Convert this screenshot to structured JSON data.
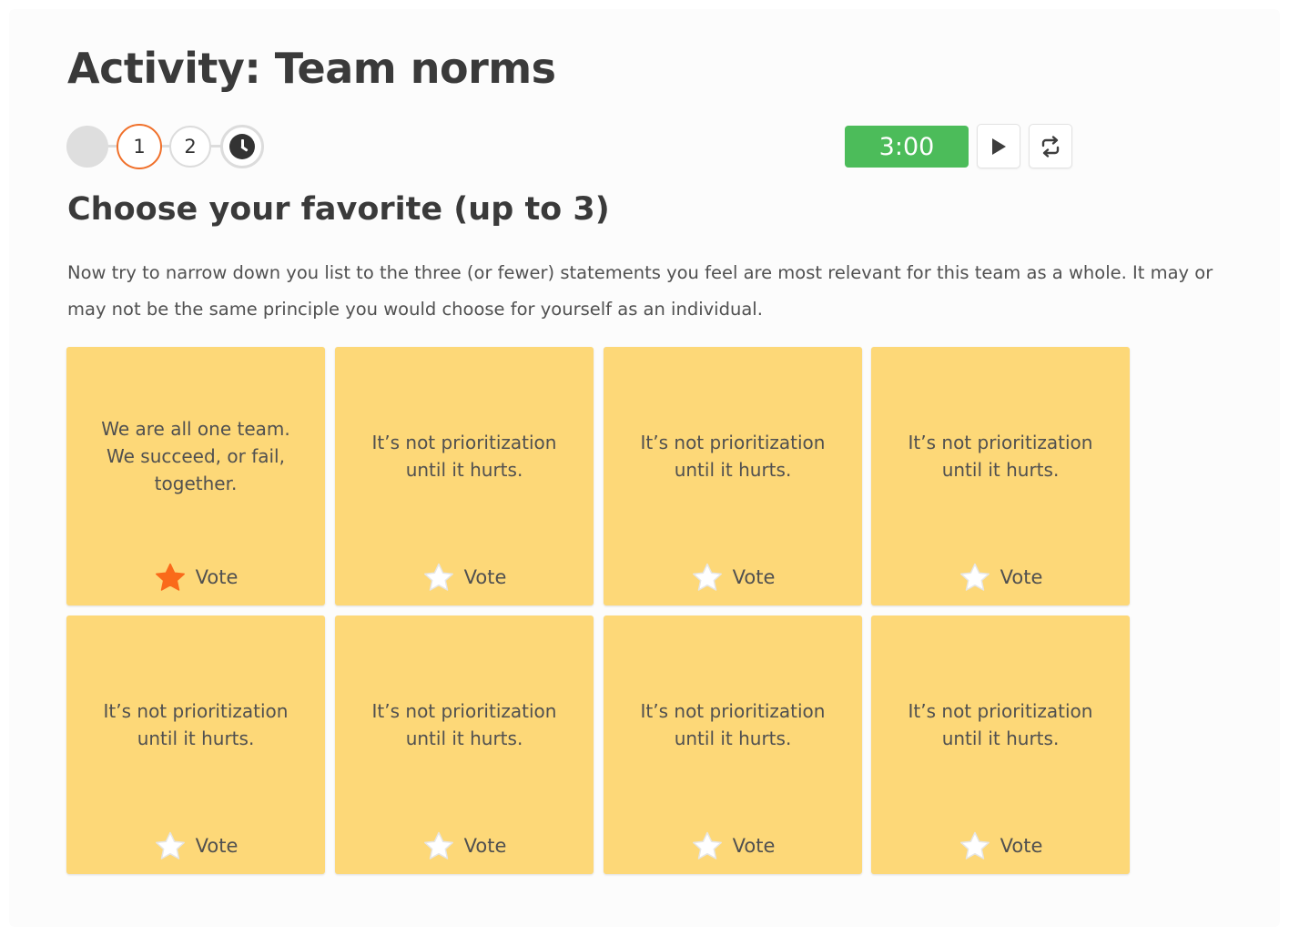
{
  "page": {
    "title": "Activity: Team norms",
    "subtitle": "Choose your favorite (up to 3)",
    "description": "Now try to narrow down you list to the three (or fewer) statements you feel are most relevant for this team as a whole. It may or may not be the same principle you would choose for yourself as an individual."
  },
  "steps": {
    "items": [
      {
        "label": "",
        "state": "done"
      },
      {
        "label": "1",
        "state": "current"
      },
      {
        "label": "2",
        "state": "upcoming"
      },
      {
        "label": "",
        "icon": "clock-icon",
        "state": "upcoming"
      }
    ]
  },
  "timer": {
    "value": "3:00",
    "color": "#4cbc5a",
    "play_icon": "play-icon",
    "repeat_icon": "repeat-icon"
  },
  "colors": {
    "card": "#fdd878",
    "accent": "#f0702a",
    "star_empty": "#ffffff",
    "star_selected": "#fa6a1a"
  },
  "cards": [
    {
      "text": "We are all one team. We succeed, or fail, together.",
      "vote_label": "Vote",
      "voted": true
    },
    {
      "text": "It’s not prioritization until it hurts.",
      "vote_label": "Vote",
      "voted": false
    },
    {
      "text": "It’s not prioritization until it hurts.",
      "vote_label": "Vote",
      "voted": false
    },
    {
      "text": "It’s not prioritization until it hurts.",
      "vote_label": "Vote",
      "voted": false
    },
    {
      "text": "It’s not prioritization until it hurts.",
      "vote_label": "Vote",
      "voted": false
    },
    {
      "text": "It’s not prioritization until it hurts.",
      "vote_label": "Vote",
      "voted": false
    },
    {
      "text": "It’s not prioritization until it hurts.",
      "vote_label": "Vote",
      "voted": false
    },
    {
      "text": "It’s not prioritization until it hurts.",
      "vote_label": "Vote",
      "voted": false
    }
  ]
}
